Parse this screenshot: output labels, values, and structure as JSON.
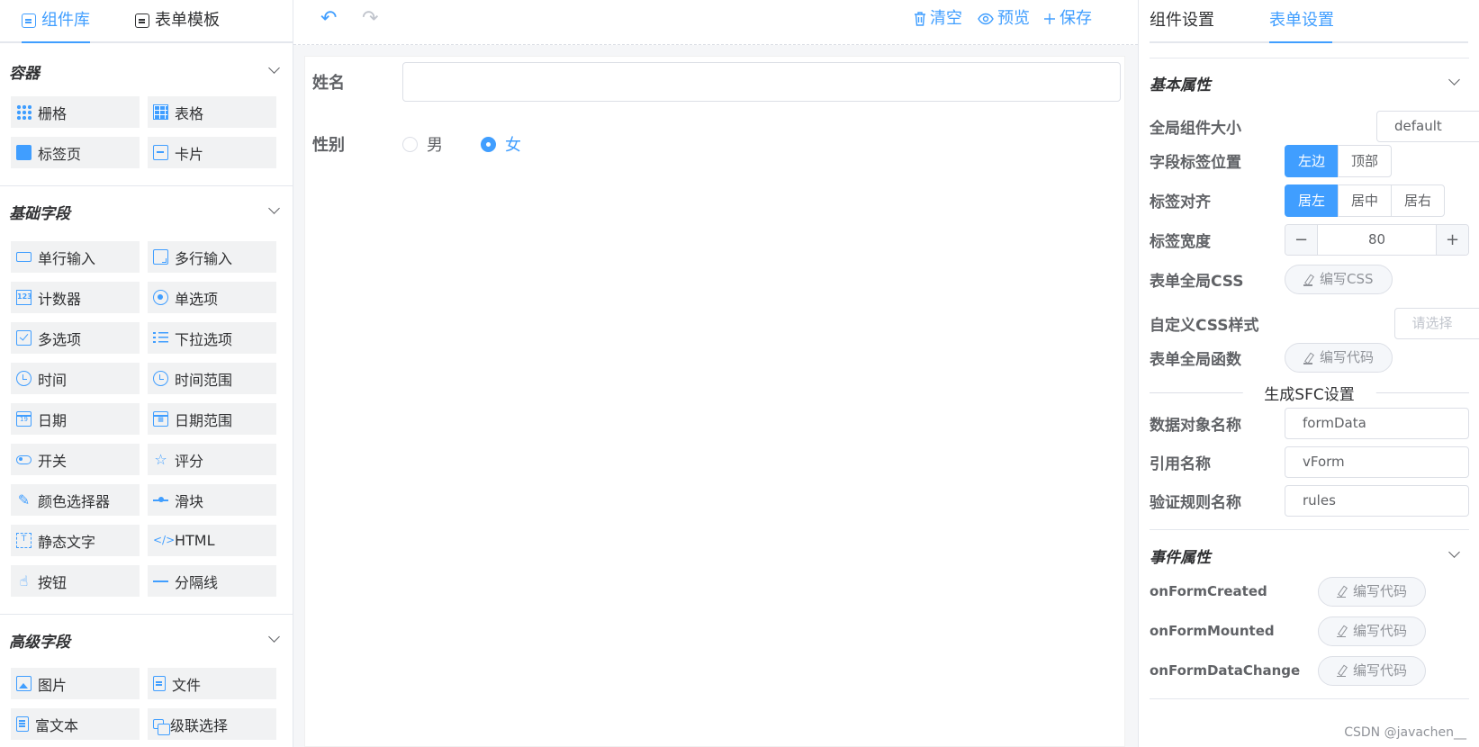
{
  "left_panel": {
    "tabs": [
      {
        "label": "组件库",
        "active": true
      },
      {
        "label": "表单模板",
        "active": false
      }
    ],
    "sections": [
      {
        "title": "容器",
        "items": [
          {
            "label": "栅格",
            "icon": "grid-icon"
          },
          {
            "label": "表格",
            "icon": "table-icon"
          },
          {
            "label": "标签页",
            "icon": "tabs-icon"
          },
          {
            "label": "卡片",
            "icon": "card-icon"
          }
        ]
      },
      {
        "title": "基础字段",
        "items": [
          {
            "label": "单行输入",
            "icon": "input-icon"
          },
          {
            "label": "多行输入",
            "icon": "textarea-icon"
          },
          {
            "label": "计数器",
            "icon": "number-icon"
          },
          {
            "label": "单选项",
            "icon": "radio-icon"
          },
          {
            "label": "多选项",
            "icon": "checkbox-icon"
          },
          {
            "label": "下拉选项",
            "icon": "select-icon"
          },
          {
            "label": "时间",
            "icon": "time-icon"
          },
          {
            "label": "时间范围",
            "icon": "time-range-icon"
          },
          {
            "label": "日期",
            "icon": "date-icon"
          },
          {
            "label": "日期范围",
            "icon": "date-range-icon"
          },
          {
            "label": "开关",
            "icon": "switch-icon"
          },
          {
            "label": "评分",
            "icon": "star-icon"
          },
          {
            "label": "颜色选择器",
            "icon": "color-picker-icon"
          },
          {
            "label": "滑块",
            "icon": "slider-icon"
          },
          {
            "label": "静态文字",
            "icon": "static-text-icon"
          },
          {
            "label": "HTML",
            "icon": "html-icon"
          },
          {
            "label": "按钮",
            "icon": "button-icon"
          },
          {
            "label": "分隔线",
            "icon": "divider-icon"
          }
        ]
      },
      {
        "title": "高级字段",
        "items": [
          {
            "label": "图片",
            "icon": "image-icon"
          },
          {
            "label": "文件",
            "icon": "file-icon"
          },
          {
            "label": "富文本",
            "icon": "rich-text-icon"
          },
          {
            "label": "级联选择",
            "icon": "cascader-icon"
          }
        ]
      }
    ]
  },
  "toolbar": {
    "undo_label": "↶",
    "redo_label": "↷",
    "clear_label": "清空",
    "preview_label": "预览",
    "save_label": "保存"
  },
  "canvas": {
    "fields": [
      {
        "label": "姓名",
        "type": "input",
        "value": ""
      },
      {
        "label": "性别",
        "type": "radio",
        "options": [
          {
            "label": "男",
            "checked": false
          },
          {
            "label": "女",
            "checked": true
          }
        ]
      }
    ]
  },
  "right_panel": {
    "tabs": [
      {
        "label": "组件设置",
        "active": false
      },
      {
        "label": "表单设置",
        "active": true
      }
    ],
    "basic": {
      "title": "基本属性",
      "size_label": "全局组件大小",
      "size_value": "default",
      "label_position_label": "字段标签位置",
      "label_position_options": [
        "左边",
        "顶部"
      ],
      "label_align_label": "标签对齐",
      "label_align_options": [
        "居左",
        "居中",
        "居右"
      ],
      "label_width_label": "标签宽度",
      "label_width_value": "80",
      "css_label": "表单全局CSS",
      "css_button": "编写CSS",
      "custom_css_label": "自定义CSS样式",
      "custom_css_placeholder": "请选择",
      "functions_label": "表单全局函数",
      "functions_button": "编写代码",
      "sfc_divider": "生成SFC设置",
      "data_object_label": "数据对象名称",
      "data_object_value": "formData",
      "ref_name_label": "引用名称",
      "ref_name_value": "vForm",
      "rules_name_label": "验证规则名称",
      "rules_name_value": "rules"
    },
    "events": {
      "title": "事件属性",
      "items": [
        {
          "label": "onFormCreated",
          "button": "编写代码"
        },
        {
          "label": "onFormMounted",
          "button": "编写代码"
        },
        {
          "label": "onFormDataChange",
          "button": "编写代码"
        }
      ]
    }
  },
  "watermark": "CSDN @javachen__",
  "colors": {
    "accent": "#409eff",
    "component_bg": "#f1f2f3",
    "canvas_bg": "#f5f6f8"
  }
}
